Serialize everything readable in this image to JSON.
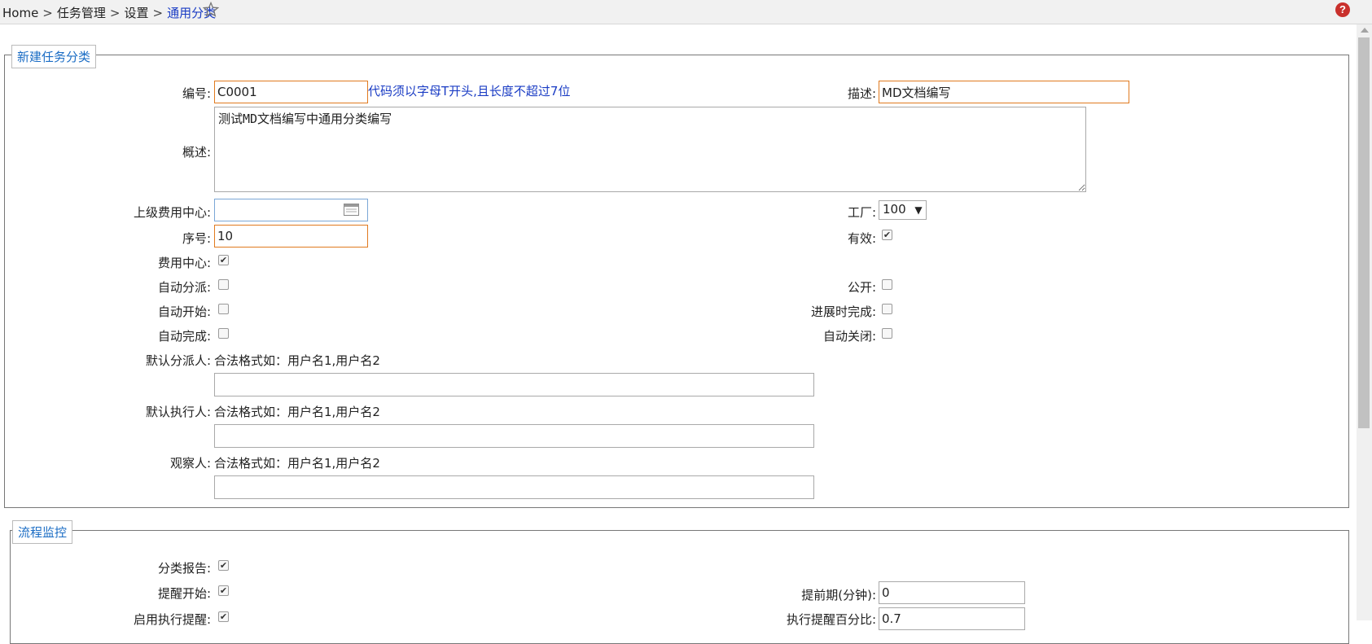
{
  "breadcrumb": {
    "home": "Home",
    "separator": ">",
    "level1": "任务管理",
    "level2": "设置",
    "current": "通用分类"
  },
  "icons": {
    "favorite": "star-outline-icon",
    "help": "help-icon",
    "calendar": "calendar-icon"
  },
  "help_label": "?",
  "section1": {
    "legend": "新建任务分类",
    "code_label": "编号:",
    "code_value": "C0001",
    "code_hint": "代码须以字母T开头,且长度不超过7位",
    "desc_label": "描述:",
    "desc_value": "MD文档编写",
    "summary_label": "概述:",
    "summary_value": "测试MD文档编写中通用分类编写",
    "parent_cost_label": "上级费用中心:",
    "parent_cost_value": "",
    "factory_label": "工厂:",
    "factory_value": "100",
    "seq_label": "序号:",
    "seq_value": "10",
    "valid_label": "有效:",
    "valid_checked": true,
    "cost_center_label": "费用中心:",
    "cost_center_checked": true,
    "auto_assign_label": "自动分派:",
    "auto_assign_checked": false,
    "public_label": "公开:",
    "public_checked": false,
    "auto_start_label": "自动开始:",
    "auto_start_checked": false,
    "progress_complete_label": "进展时完成:",
    "progress_complete_checked": false,
    "auto_complete_label": "自动完成:",
    "auto_complete_checked": false,
    "auto_close_label": "自动关闭:",
    "auto_close_checked": false,
    "default_assigner_label": "默认分派人:",
    "default_executor_label": "默认执行人:",
    "observer_label": "观察人:",
    "format_hint": "合法格式如：用户名1,用户名2",
    "default_assigner_value": "",
    "default_executor_value": "",
    "observer_value": ""
  },
  "section2": {
    "legend": "流程监控",
    "category_report_label": "分类报告:",
    "category_report_checked": true,
    "remind_start_label": "提醒开始:",
    "remind_start_checked": true,
    "advance_label": "提前期(分钟):",
    "advance_value": "0",
    "exec_remind_label": "启用执行提醒:",
    "exec_remind_checked": true,
    "exec_percent_label": "执行提醒百分比:",
    "exec_percent_value": "0.7"
  },
  "colors": {
    "accent_link": "#1a3cc4",
    "legend_text": "#1a6cc4",
    "required_border": "#e07a1f",
    "help_bg": "#c9302c"
  }
}
